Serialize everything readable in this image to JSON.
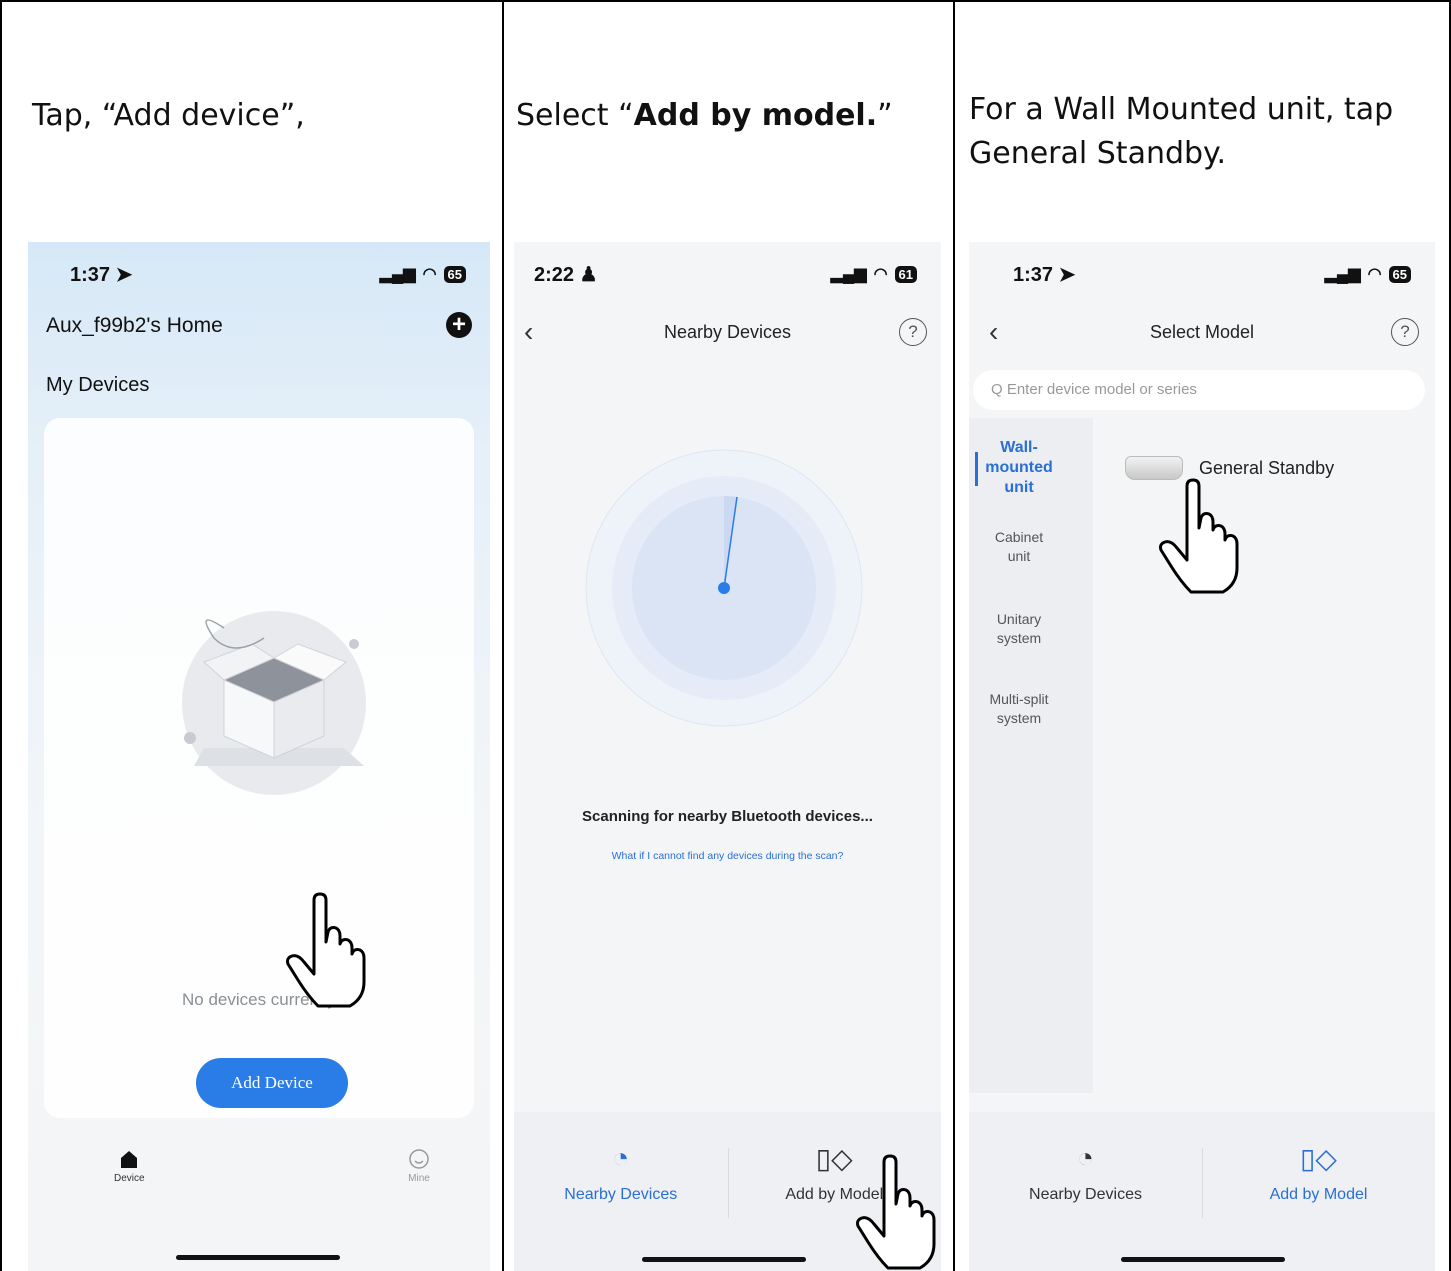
{
  "panel1": {
    "caption": "Tap, “Add device”,",
    "status_time": "1:37 ➤",
    "battery": "65",
    "home_title": "Aux_f99b2's Home",
    "my_devices": "My Devices",
    "empty_text": "No devices currently",
    "add_device_button": "Add Device",
    "tab_device": "Device",
    "tab_mine": "Mine"
  },
  "panel2": {
    "caption_prefix": "Select “",
    "caption_bold": "Add by model.",
    "caption_suffix": "”",
    "status_time": "2:22 ♟",
    "battery": "61",
    "nav_title": "Nearby Devices",
    "help": "?",
    "scan_text": "Scanning for nearby Bluetooth devices...",
    "scan_link": "What if I cannot find any devices during the scan?",
    "tab_nearby": "Nearby Devices",
    "tab_add_by_model": "Add by Model"
  },
  "panel3": {
    "caption": "For a Wall Mounted unit, tap General Standby.",
    "status_time": "1:37 ➤",
    "battery": "65",
    "nav_title": "Select Model",
    "help": "?",
    "search_placeholder": "Q Enter device model or series",
    "categories": [
      "Wall-\nmounted\nunit",
      "Cabinet\nunit",
      "Unitary\nsystem",
      "Multi-split\nsystem"
    ],
    "model_name": "General Standby",
    "tab_nearby": "Nearby Devices",
    "tab_add_by_model": "Add by Model"
  },
  "colors": {
    "accent": "#2a7ce6",
    "link": "#2a6fd6",
    "border": "#000000"
  },
  "icons": [
    "location-arrow-icon",
    "signal-icon",
    "wifi-icon",
    "battery-icon",
    "add-circle-icon",
    "back-icon",
    "help-icon",
    "radar-icon",
    "gauge-icon",
    "grid-model-icon",
    "home-icon",
    "mine-icon",
    "pointing-hand-icon"
  ]
}
